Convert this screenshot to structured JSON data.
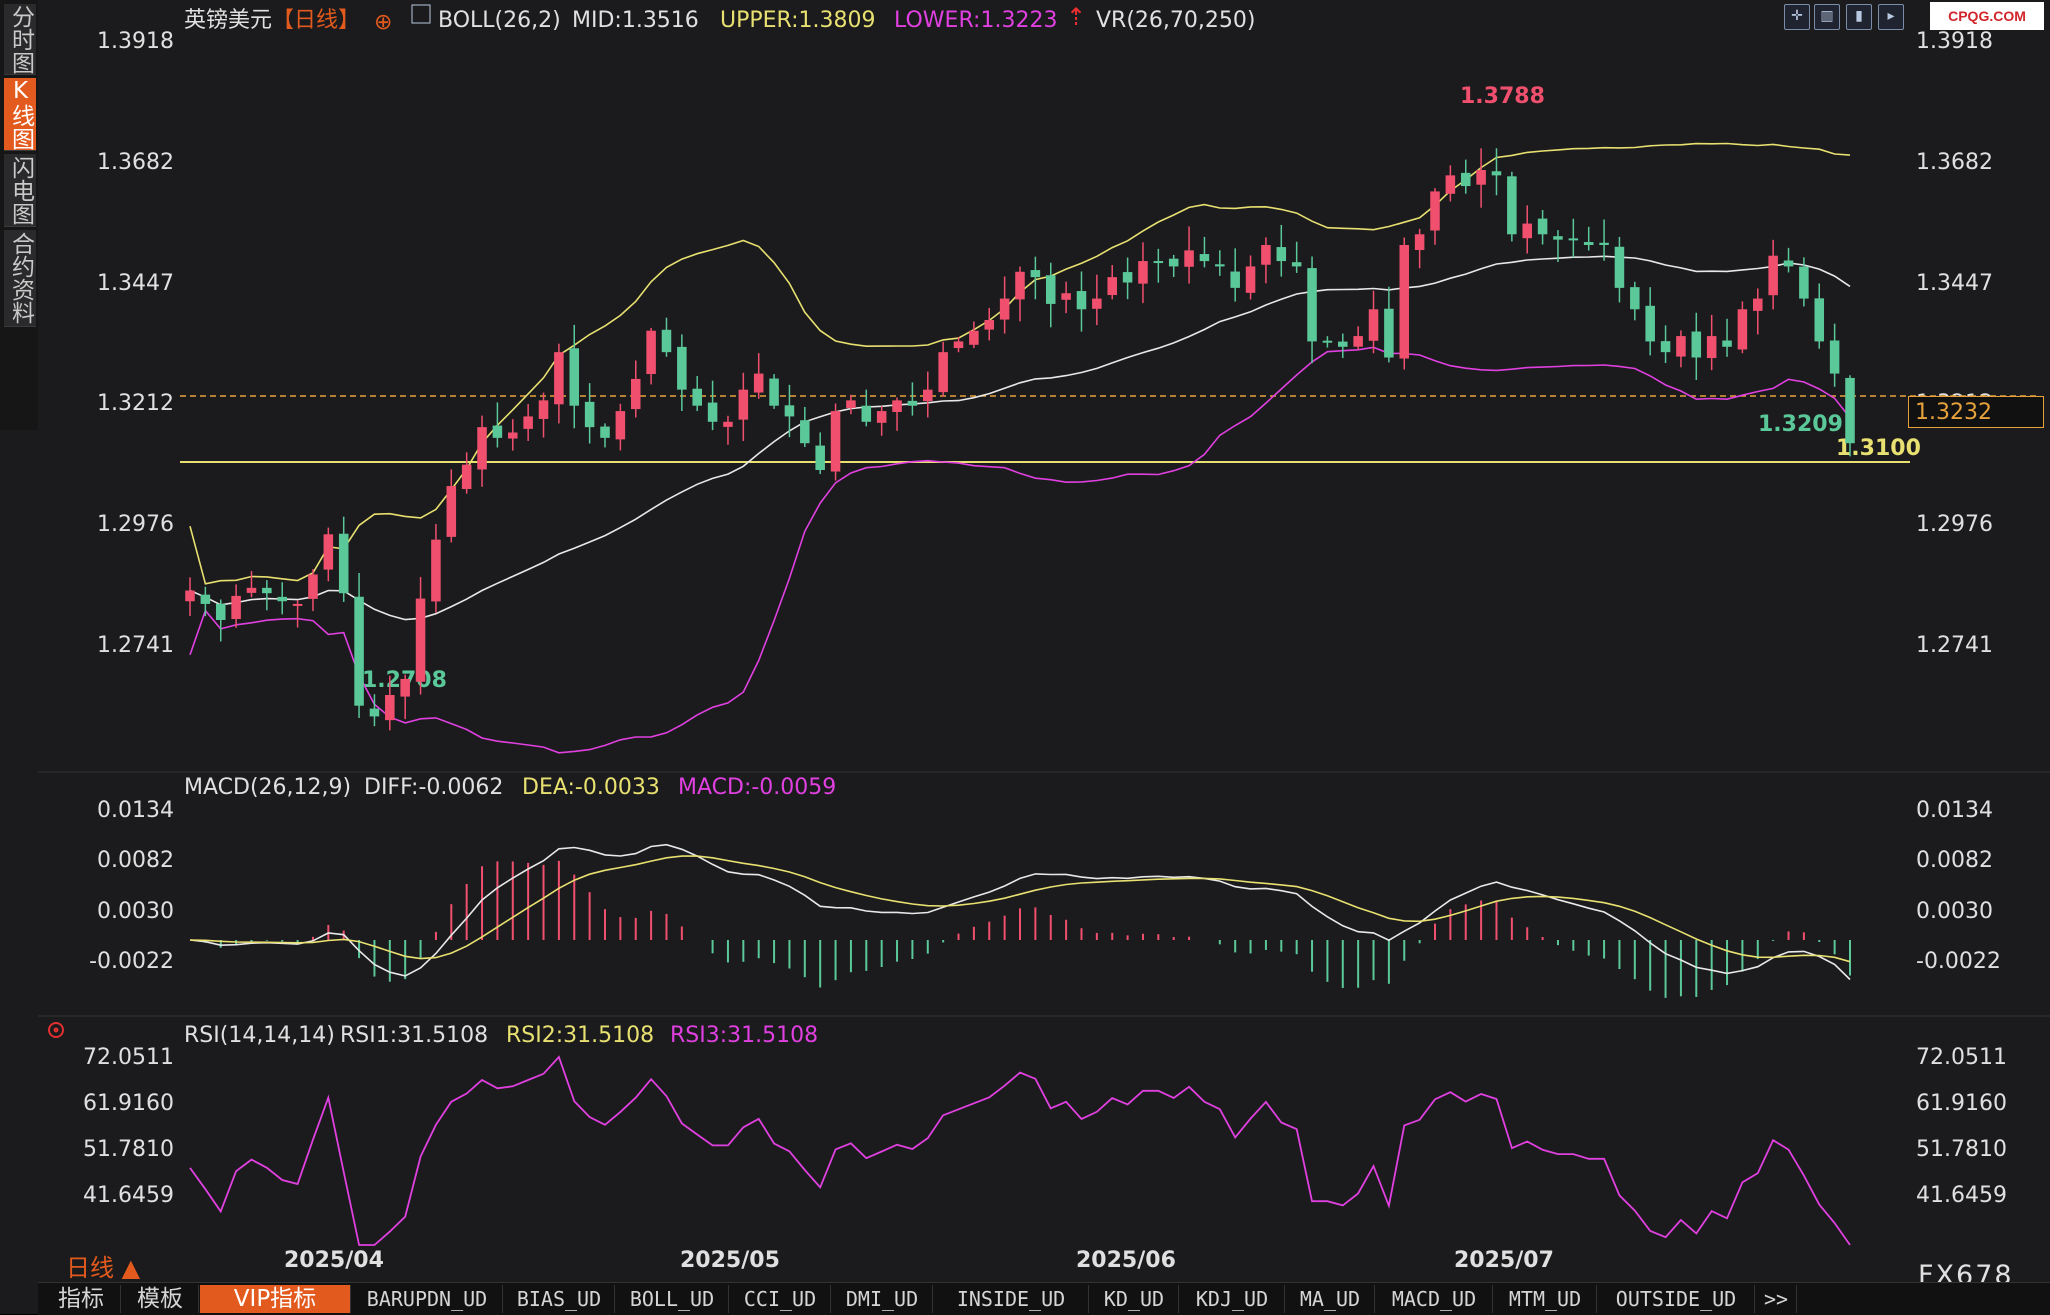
{
  "side_tabs": [
    "分时图",
    "K线图",
    "闪电图",
    "合约资料"
  ],
  "side_tabs_active": 1,
  "header": {
    "symbol": "英镑美元",
    "period": "【日线】",
    "boll_label": "BOLL(26,2)",
    "mid": "MID:1.3516",
    "upper": "UPPER:1.3809",
    "lower": "LOWER:1.3223",
    "vr_label": "VR(26,70,250)"
  },
  "price_axis": [
    "1.3918",
    "1.3682",
    "1.3447",
    "1.3212",
    "1.2976",
    "1.2741"
  ],
  "annotations": {
    "high": "1.3788",
    "low": "1.2708",
    "recent_low": "1.3209",
    "support_line": "1.3100",
    "current_price": "1.3232"
  },
  "macd": {
    "label": "MACD(26,12,9)",
    "diff": "DIFF:-0.0062",
    "dea": "DEA:-0.0033",
    "macd": "MACD:-0.0059",
    "axis": [
      "0.0134",
      "0.0082",
      "0.0030",
      "-0.0022"
    ]
  },
  "rsi": {
    "label": "RSI(14,14,14)",
    "rsi1": "RSI1:31.5108",
    "rsi2": "RSI2:31.5108",
    "rsi3": "RSI3:31.5108",
    "axis": [
      "72.0511",
      "61.9160",
      "51.7810",
      "41.6459"
    ]
  },
  "date_axis": [
    "2025/04",
    "2025/05",
    "2025/06",
    "2025/07"
  ],
  "period_label": "日线 ▲",
  "bottom_tabs": [
    "指标",
    "模板",
    "VIP指标",
    "BARUPDN_UD",
    "BIAS_UD",
    "BOLL_UD",
    "CCI_UD",
    "DMI_UD",
    "INSIDE_UD",
    "KD_UD",
    "KDJ_UD",
    "MA_UD",
    "MACD_UD",
    "MTM_UD",
    "OUTSIDE_UD",
    ">>"
  ],
  "bottom_tabs_active": 2,
  "watermark": "FX678",
  "logo": "CPQG.COM",
  "colors": {
    "up": "#f0506e",
    "down": "#5bc89a",
    "upper": "#e8e070",
    "mid": "#e8e8e8",
    "lower": "#e040e0",
    "accent": "#e35a1e"
  },
  "chart_data": {
    "type": "candlestick",
    "series_close": [
      1.2955,
      1.293,
      1.29,
      1.2945,
      1.296,
      1.295,
      1.2935,
      1.293,
      1.2985,
      1.306,
      1.295,
      1.274,
      1.272,
      1.276,
      1.279,
      1.294,
      1.305,
      1.315,
      1.319,
      1.326,
      1.324,
      1.325,
      1.328,
      1.331,
      1.34,
      1.33,
      1.326,
      1.324,
      1.329,
      1.335,
      1.344,
      1.34,
      1.333,
      1.33,
      1.327,
      1.327,
      1.333,
      1.336,
      1.33,
      1.328,
      1.323,
      1.318,
      1.329,
      1.331,
      1.327,
      1.329,
      1.331,
      1.33,
      1.333,
      1.34,
      1.342,
      1.344,
      1.346,
      1.35,
      1.355,
      1.354,
      1.349,
      1.351,
      1.348,
      1.35,
      1.354,
      1.353,
      1.357,
      1.357,
      1.356,
      1.359,
      1.357,
      1.356,
      1.352,
      1.356,
      1.36,
      1.357,
      1.356,
      1.342,
      1.342,
      1.341,
      1.343,
      1.348,
      1.339,
      1.36,
      1.362,
      1.37,
      1.373,
      1.371,
      1.374,
      1.373,
      1.362,
      1.364,
      1.362,
      1.361,
      1.361,
      1.36,
      1.36,
      1.352,
      1.348,
      1.342,
      1.34,
      1.343,
      1.339,
      1.343,
      1.341,
      1.348,
      1.35,
      1.358,
      1.356,
      1.35,
      1.342,
      1.336,
      1.323
    ],
    "price_range": [
      1.262,
      1.402
    ],
    "macd_range": [
      -0.008,
      0.016
    ],
    "rsi_range": [
      33,
      76
    ]
  }
}
